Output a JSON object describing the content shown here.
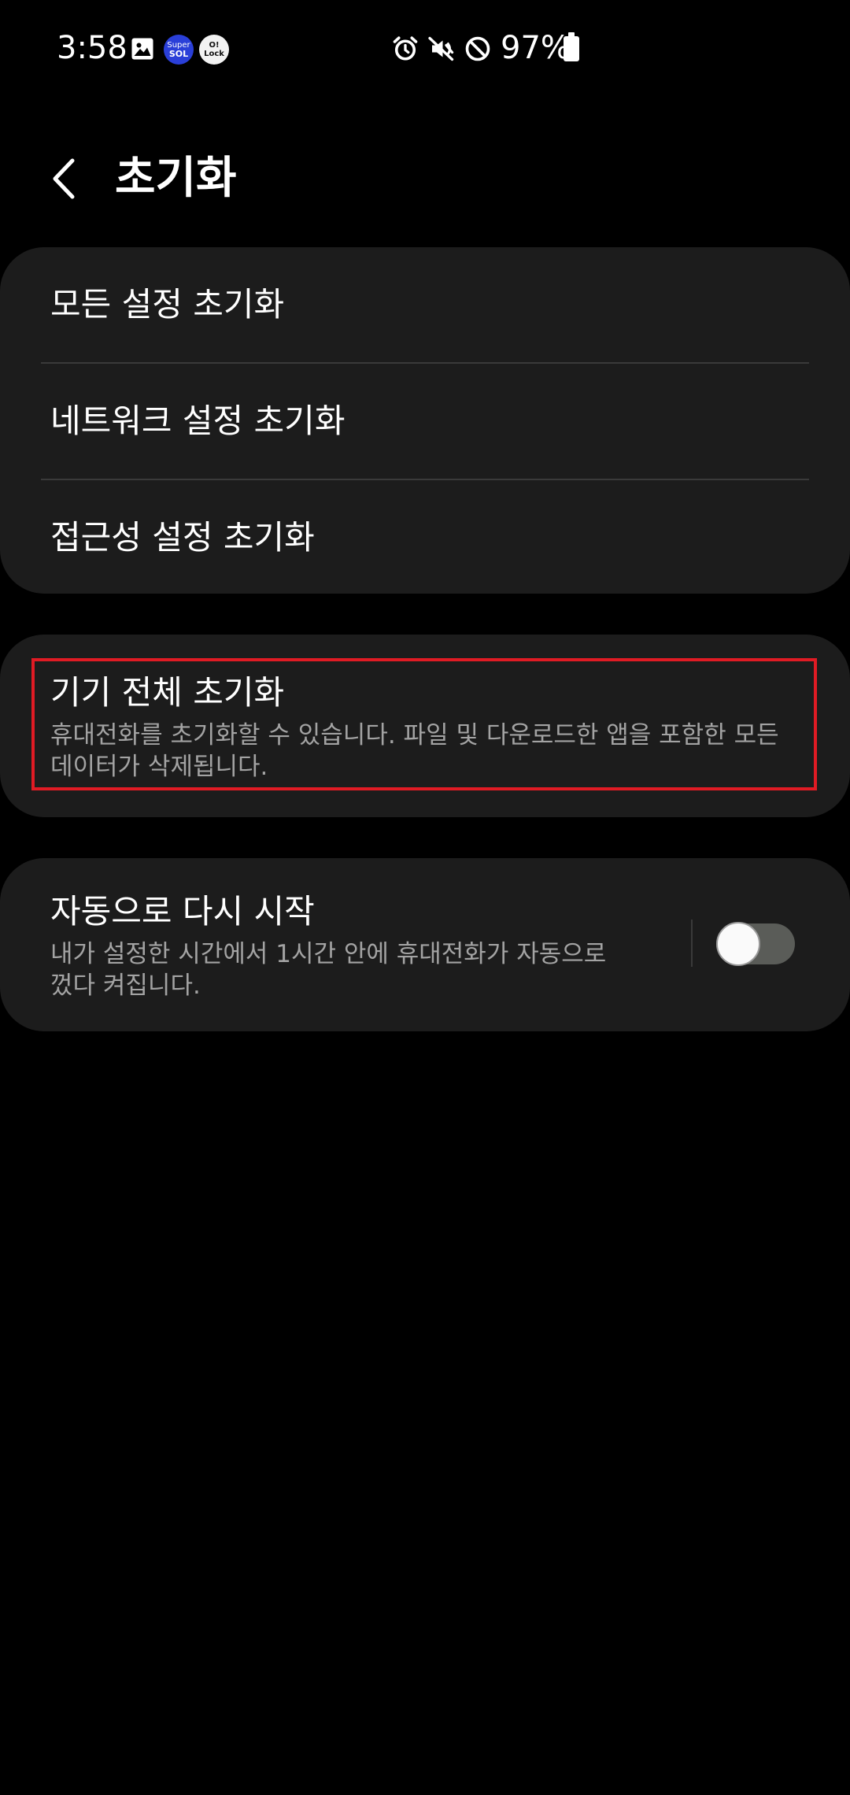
{
  "status_bar": {
    "time": "3:58",
    "app_icons": [
      {
        "name": "super-sol-icon",
        "line1": "Super",
        "line2": "SOL"
      },
      {
        "name": "o-lock-icon",
        "line1": "O!",
        "line2": "Lock"
      }
    ],
    "battery_percent": "97%",
    "battery_level": 0.97
  },
  "header": {
    "title": "초기화"
  },
  "reset_list": {
    "items": [
      {
        "label": "모든 설정 초기화"
      },
      {
        "label": "네트워크 설정 초기화"
      },
      {
        "label": "접근성 설정 초기화"
      }
    ]
  },
  "factory_reset": {
    "title": "기기 전체 초기화",
    "description": "휴대전화를 초기화할 수 있습니다. 파일 및 다운로드한 앱을 포함한 모든 데이터가 삭제됩니다.",
    "highlight_color": "#e01b24"
  },
  "auto_restart": {
    "title": "자동으로 다시 시작",
    "description": "내가 설정한 시간에서 1시간 안에 휴대전화가 자동으로 껐다 켜집니다.",
    "toggle_on": false
  },
  "colors": {
    "background": "#000000",
    "card": "#1c1c1c",
    "secondary_text": "#a3a3a3"
  }
}
